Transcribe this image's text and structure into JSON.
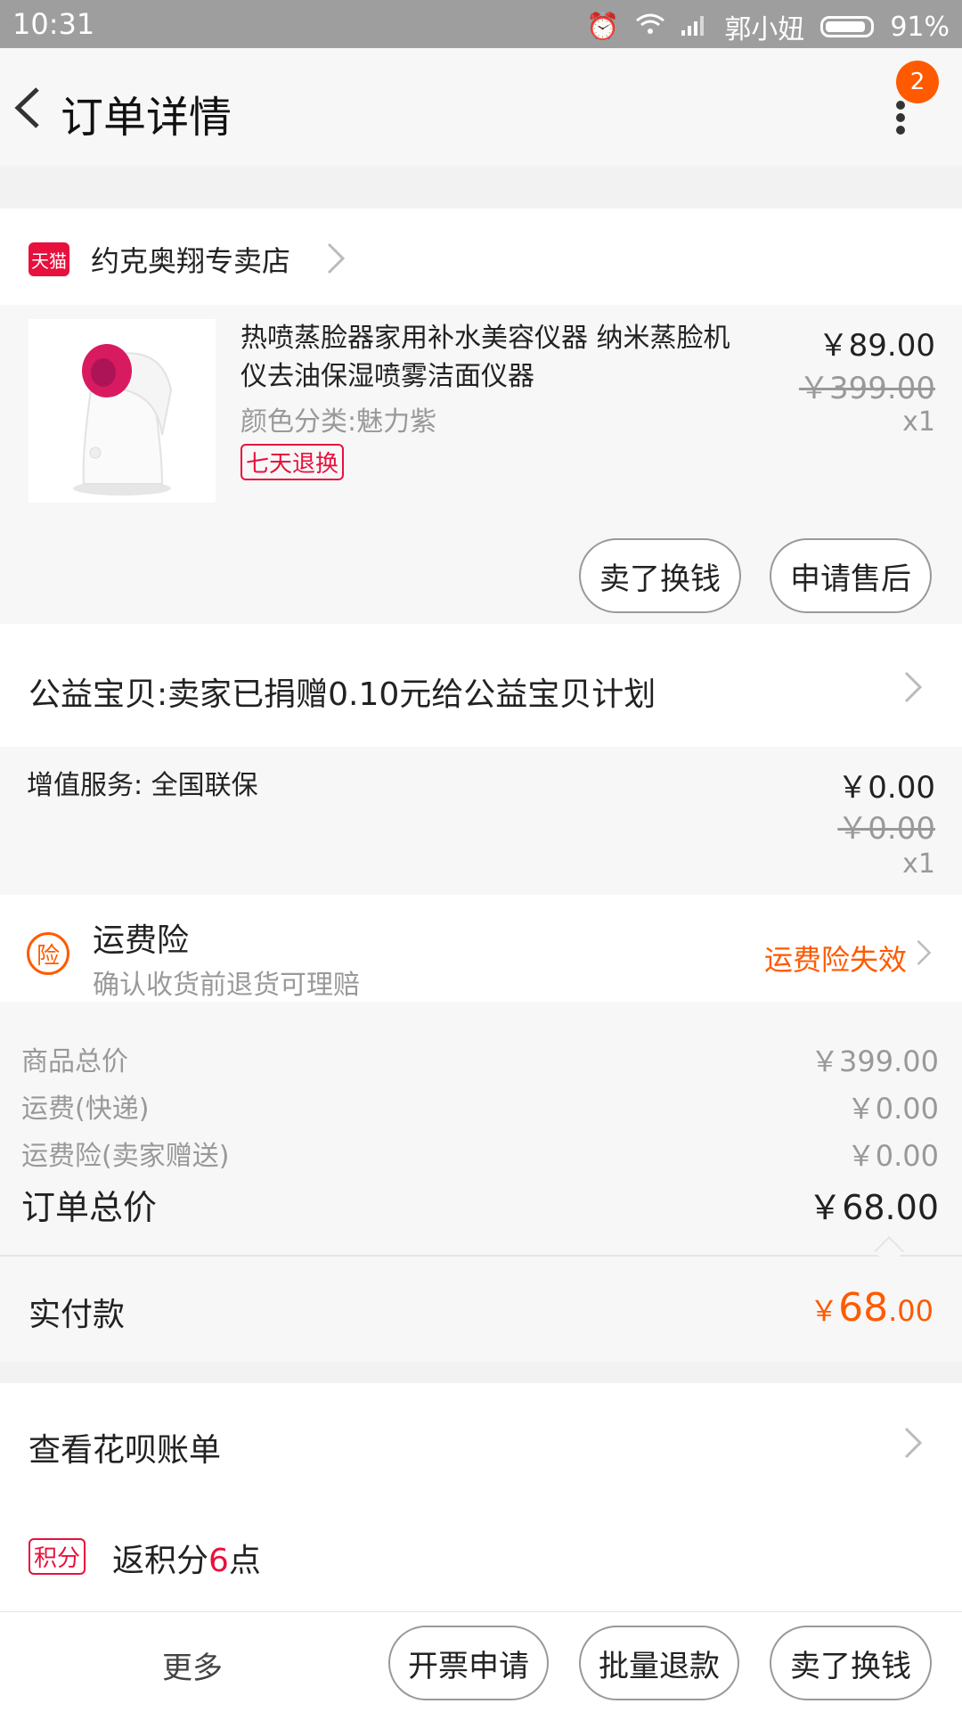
{
  "status_bar": {
    "time": "10:31",
    "carrier": "郭小妞",
    "battery": "91%"
  },
  "header": {
    "title": "订单详情",
    "badge_count": "2"
  },
  "store": {
    "icon_label": "天猫",
    "name": "约克奥翔专卖店"
  },
  "product": {
    "title": "热喷蒸脸器家用补水美容仪器 纳米蒸脸机仪去油保湿喷雾洁面仪器",
    "spec": "颜色分类:魅力紫",
    "tag": "七天退换",
    "price": "￥89.00",
    "original_price": "￥399.00",
    "quantity": "x1",
    "buttons": [
      "卖了换钱",
      "申请售后"
    ]
  },
  "charity": {
    "text": "公益宝贝:卖家已捐赠0.10元给公益宝贝计划"
  },
  "value_added": {
    "label": "增值服务: 全国联保",
    "price": "￥0.00",
    "original_price": "￥0.00",
    "quantity": "x1"
  },
  "freight_insurance": {
    "icon_label": "险",
    "title": "运费险",
    "desc": "确认收货前退货可理赔",
    "status": "运费险失效"
  },
  "summary": {
    "rows": [
      {
        "label": "商品总价",
        "value": "￥399.00"
      },
      {
        "label": "运费(快递)",
        "value": "￥0.00"
      },
      {
        "label": "运费险(卖家赠送)",
        "value": "￥0.00"
      }
    ],
    "total_label": "订单总价",
    "total_value": "￥68.00"
  },
  "paid": {
    "label": "实付款",
    "currency": "￥",
    "amount_int": "68",
    "amount_dec": ".00"
  },
  "huabei": {
    "text": "查看花呗账单"
  },
  "points": {
    "tag": "积分",
    "prefix": "返积分",
    "value": "6",
    "suffix": "点"
  },
  "bottom_bar": {
    "more": "更多",
    "buttons": [
      "开票申请",
      "批量退款",
      "卖了换钱"
    ]
  },
  "colors": {
    "accent": "#ff5a00",
    "tmall_red": "#e8103d",
    "status_bar": "#9e9e9e"
  }
}
